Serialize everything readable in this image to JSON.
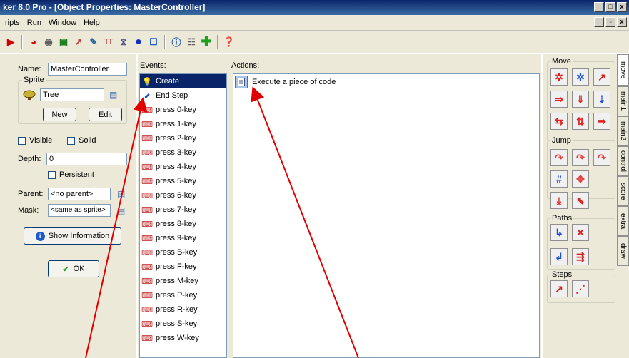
{
  "window": {
    "title": "ker 8.0 Pro - [Object Properties: MasterController]",
    "min": "_",
    "max": "□",
    "close": "x",
    "mdi_min": "_",
    "mdi_restore": "▫",
    "mdi_close": "x"
  },
  "menu": [
    "ripts",
    "Run",
    "Window",
    "Help"
  ],
  "left": {
    "name_label": "Name:",
    "name_value": "MasterController",
    "sprite_group": "Sprite",
    "sprite_value": "Tree",
    "new_label": "New",
    "edit_label": "Edit",
    "visible_label": "Visible",
    "solid_label": "Solid",
    "depth_label": "Depth:",
    "depth_value": "0",
    "persistent_label": "Persistent",
    "parent_label": "Parent:",
    "parent_value": "<no parent>",
    "mask_label": "Mask:",
    "mask_value": "<same as sprite>",
    "show_info_label": "Show Information",
    "ok_label": "OK"
  },
  "events": {
    "header": "Events:",
    "items": [
      {
        "label": "Create",
        "icon": "lightbulb-icon",
        "glyph": "💡",
        "color": "#ffd800"
      },
      {
        "label": "End Step",
        "icon": "footstep-icon",
        "glyph": "⬋",
        "color": "#2050c0"
      },
      {
        "label": "press 0-key",
        "icon": "keyboard-icon",
        "glyph": "⌨",
        "color": "#c02020"
      },
      {
        "label": "press 1-key",
        "icon": "keyboard-icon",
        "glyph": "⌨",
        "color": "#c02020"
      },
      {
        "label": "press 2-key",
        "icon": "keyboard-icon",
        "glyph": "⌨",
        "color": "#c02020"
      },
      {
        "label": "press 3-key",
        "icon": "keyboard-icon",
        "glyph": "⌨",
        "color": "#c02020"
      },
      {
        "label": "press 4-key",
        "icon": "keyboard-icon",
        "glyph": "⌨",
        "color": "#c02020"
      },
      {
        "label": "press 5-key",
        "icon": "keyboard-icon",
        "glyph": "⌨",
        "color": "#c02020"
      },
      {
        "label": "press 6-key",
        "icon": "keyboard-icon",
        "glyph": "⌨",
        "color": "#c02020"
      },
      {
        "label": "press 7-key",
        "icon": "keyboard-icon",
        "glyph": "⌨",
        "color": "#c02020"
      },
      {
        "label": "press 8-key",
        "icon": "keyboard-icon",
        "glyph": "⌨",
        "color": "#c02020"
      },
      {
        "label": "press 9-key",
        "icon": "keyboard-icon",
        "glyph": "⌨",
        "color": "#c02020"
      },
      {
        "label": "press B-key",
        "icon": "keyboard-icon",
        "glyph": "⌨",
        "color": "#c02020"
      },
      {
        "label": "press F-key",
        "icon": "keyboard-icon",
        "glyph": "⌨",
        "color": "#c02020"
      },
      {
        "label": "press M-key",
        "icon": "keyboard-icon",
        "glyph": "⌨",
        "color": "#c02020"
      },
      {
        "label": "press P-key",
        "icon": "keyboard-icon",
        "glyph": "⌨",
        "color": "#c02020"
      },
      {
        "label": "press R-key",
        "icon": "keyboard-icon",
        "glyph": "⌨",
        "color": "#c02020"
      },
      {
        "label": "press S-key",
        "icon": "keyboard-icon",
        "glyph": "⌨",
        "color": "#c02020"
      },
      {
        "label": "press W-key",
        "icon": "keyboard-icon",
        "glyph": "⌨",
        "color": "#c02020"
      }
    ]
  },
  "actions": {
    "header": "Actions:",
    "items": [
      {
        "label": "Execute a piece of code",
        "icon": "code-document-icon"
      }
    ]
  },
  "palette": {
    "move_group": "Move",
    "jump_group": "Jump",
    "paths_group": "Paths",
    "steps_group": "Steps",
    "tabs": [
      "move",
      "main1",
      "main2",
      "control",
      "score",
      "extra",
      "draw"
    ]
  },
  "colors": {
    "selection": "#0a246a",
    "annotation_arrow": "#e00000",
    "dialog_bg": "#ece9d8"
  }
}
